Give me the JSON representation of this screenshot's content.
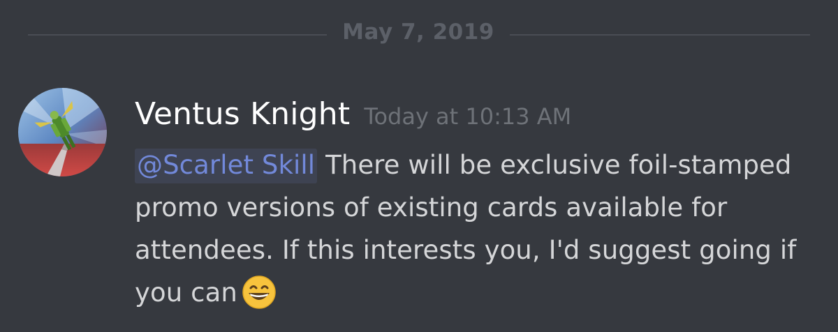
{
  "divider": {
    "date": "May 7, 2019"
  },
  "message": {
    "author": "Ventus Knight",
    "timestamp": "Today at 10:13 AM",
    "mention": "@Scarlet Skill",
    "text": "There will be exclusive foil-stamped promo versions of existing cards available for attendees. If this interests you, I'd suggest going if you can",
    "emoji": "grinning-face-emoji"
  },
  "colors": {
    "background": "#36393f",
    "username": "#ffffff",
    "timestamp": "#6e7278",
    "body_text": "#d5d6d8",
    "mention": "#7289da",
    "divider_line": "#4a4d54",
    "divider_text": "#5c6068"
  }
}
